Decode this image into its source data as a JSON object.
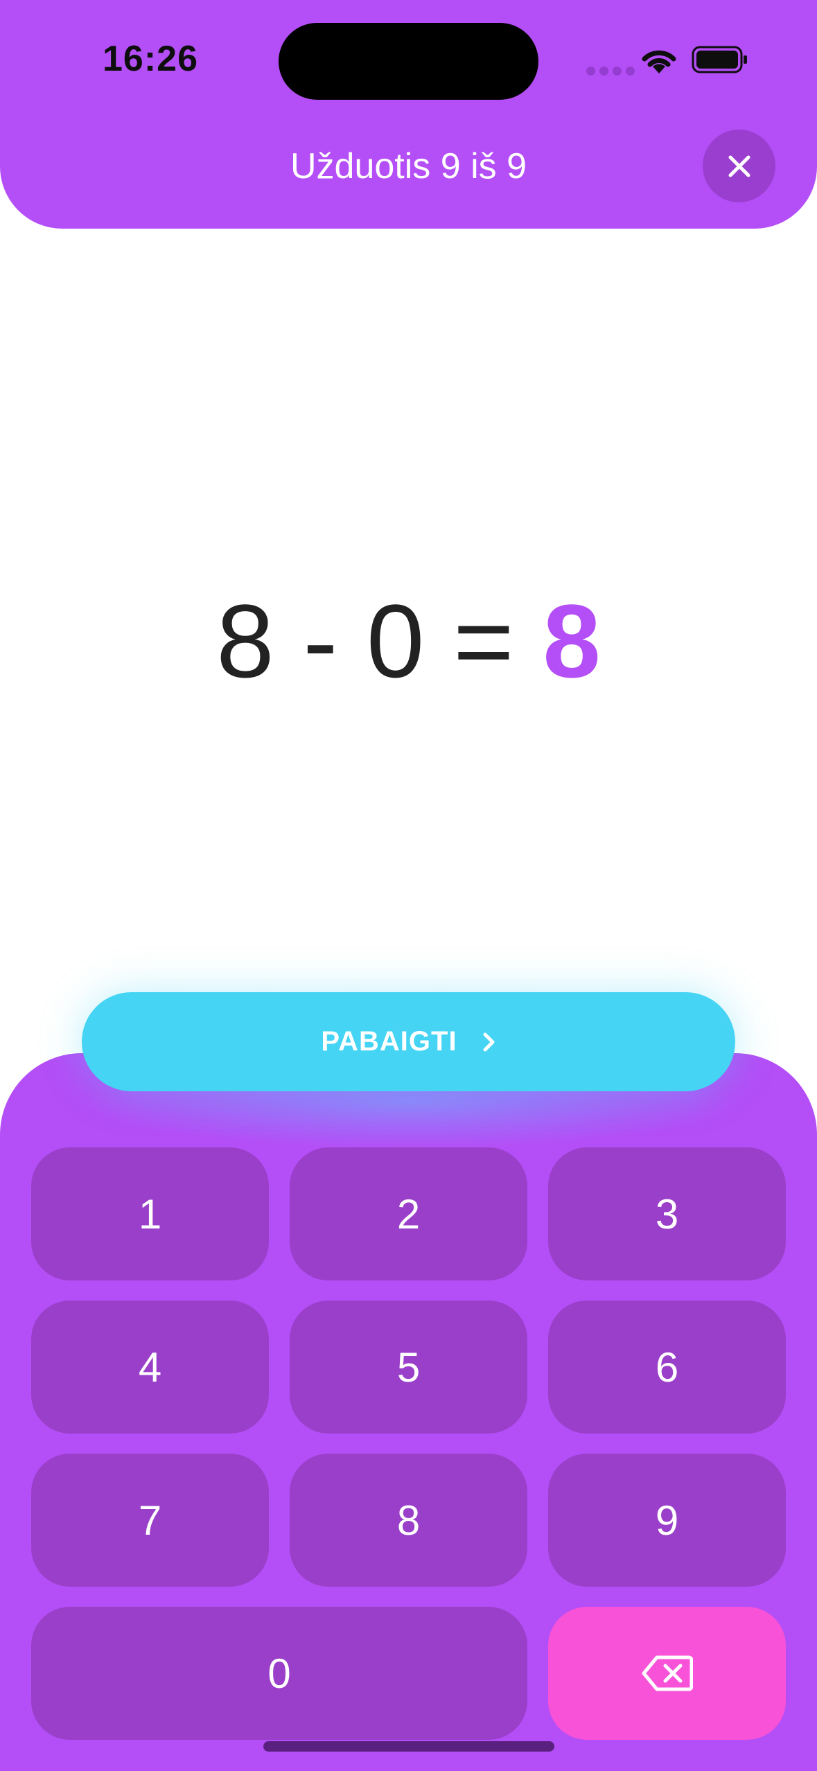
{
  "status_bar": {
    "time": "16:26"
  },
  "header": {
    "title": "Užduotis 9 iš 9",
    "close_icon": "close-icon"
  },
  "exercise": {
    "left_operand": "8",
    "operator": "-",
    "right_operand": "0",
    "equals": "=",
    "answer": "8"
  },
  "finish_button": {
    "label": "PABAIGTI",
    "icon": "chevron-right-icon"
  },
  "keypad": {
    "keys": [
      "1",
      "2",
      "3",
      "4",
      "5",
      "6",
      "7",
      "8",
      "9",
      "0"
    ],
    "backspace_icon": "backspace-icon"
  },
  "colors": {
    "primary": "#b44ef6",
    "key": "#9a3fc9",
    "finish": "#45d4f4",
    "backspace": "#f752d8"
  }
}
